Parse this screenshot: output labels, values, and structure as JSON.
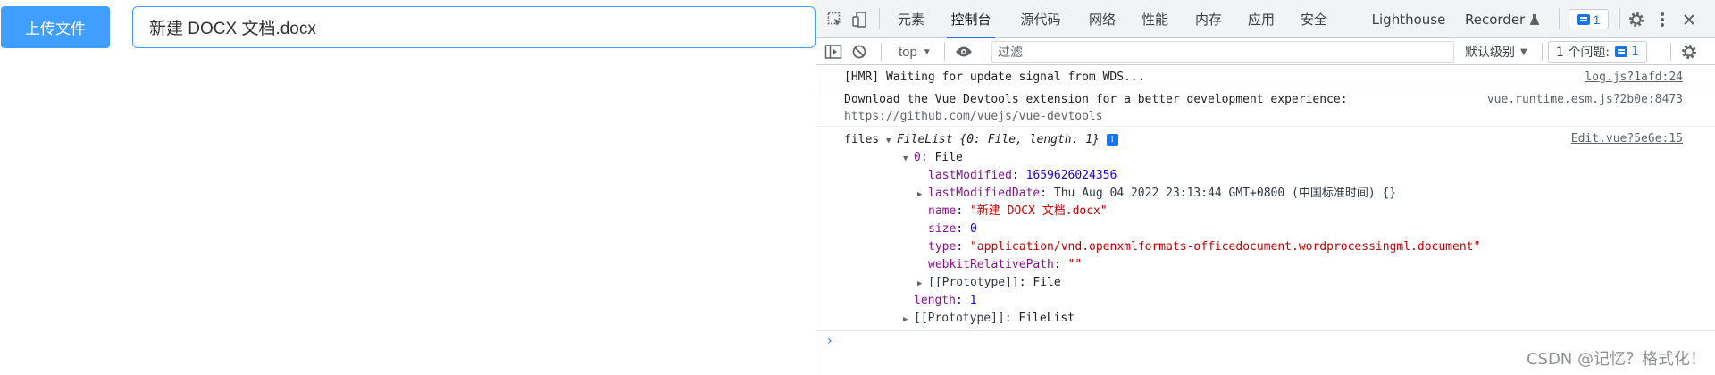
{
  "app": {
    "upload_button": "上传文件",
    "file_input_value": "新建 DOCX 文档.docx"
  },
  "devtools": {
    "tabs": [
      {
        "label": "元素"
      },
      {
        "label": "控制台",
        "active": true
      },
      {
        "label": "源代码"
      },
      {
        "label": "网络"
      },
      {
        "label": "性能"
      },
      {
        "label": "内存"
      },
      {
        "label": "应用"
      },
      {
        "label": "安全"
      },
      {
        "label": "Lighthouse"
      },
      {
        "label": "Recorder"
      }
    ],
    "issues_badge_count": "1",
    "toolbar": {
      "context": "top",
      "filter_placeholder": "过滤",
      "level": "默认级别",
      "issues_label": "1 个问题:",
      "issues_count": "1"
    },
    "console": {
      "messages": [
        {
          "text": "[HMR] Waiting for update signal from WDS...",
          "source": "log.js?1afd:24"
        },
        {
          "text": "Download the Vue Devtools extension for a better development experience:",
          "link": "https://github.com/vuejs/vue-devtools",
          "source": "vue.runtime.esm.js?2b0e:8473"
        },
        {
          "source": "Edit.vue?5e6e:15"
        }
      ],
      "files_label": "files",
      "filelist_summary": "FileList {0: File, length: 1}",
      "entry0_key": "0",
      "entry0_type": "File",
      "lastModified_key": "lastModified",
      "lastModified_val": "1659626024356",
      "lastModifiedDate_key": "lastModifiedDate",
      "lastModifiedDate_val": "Thu Aug 04 2022 23:13:44 GMT+0800 (中国标准时间) {}",
      "name_key": "name",
      "name_val": "\"新建 DOCX 文档.docx\"",
      "size_key": "size",
      "size_val": "0",
      "type_key": "type",
      "type_val": "\"application/vnd.openxmlformats-officedocument.wordprocessingml.document\"",
      "webkit_key": "webkitRelativePath",
      "webkit_val": "\"\"",
      "proto_file_key": "[[Prototype]]",
      "proto_file_val": "File",
      "length_key": "length",
      "length_val": "1",
      "proto_list_key": "[[Prototype]]",
      "proto_list_val": "FileList",
      "prompt": "›"
    }
  },
  "watermark": "CSDN @记忆？格式化！",
  "icons": [
    "inspect-icon",
    "device-icon",
    "gear-icon",
    "more-vert-icon",
    "close-icon",
    "sidebar-icon",
    "clear-icon",
    "eye-icon",
    "info-icon",
    "flask-icon",
    "message-icon"
  ]
}
